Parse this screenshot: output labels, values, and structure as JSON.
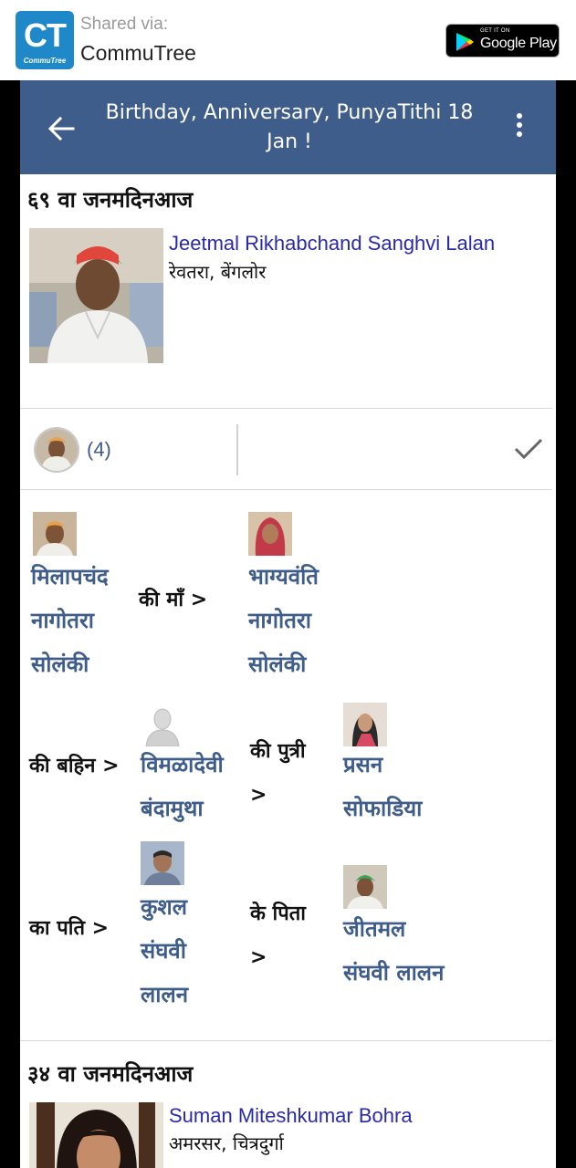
{
  "share_bar": {
    "logo_text": "CT",
    "logo_subtext": "CommuTree",
    "shared_via": "Shared via:",
    "app_name": "CommuTree",
    "store_badge": {
      "small": "GET IT ON",
      "big": "Google Play"
    }
  },
  "appbar": {
    "title": "Birthday, Anniversary, PunyaTithi 18 Jan !",
    "back_icon": "arrow-left-icon",
    "menu_icon": "more-vertical-icon"
  },
  "entries": [
    {
      "heading": "६९ वा जनमदिनआज",
      "name": "Jeetmal Rikhabchand Sanghvi Lalan",
      "place": "रेवतरा, बेंगलोर"
    },
    {
      "heading": "३४ वा जनमदिनआज",
      "name": "Suman Miteshkumar Bohra",
      "place": "अमरसर, चित्रदुर्गा"
    }
  ],
  "reactions": {
    "count": "(4)",
    "check_icon": "checkmark-icon"
  },
  "relations": {
    "row1": {
      "from_name": [
        "मिलापचंद",
        "नागोतरा",
        "सोलंकी"
      ],
      "relation": "की माँ >",
      "to_name": [
        "भाग्यवंति",
        "नागोतरा",
        "सोलंकी"
      ]
    },
    "row2": {
      "prefix": "की बहिन >",
      "from_name": [
        "विमळादेवी",
        "बंदामुथा"
      ],
      "relation": [
        "की पुत्री",
        ">"
      ],
      "to_name": [
        "प्रसन",
        "सोफाडिया"
      ]
    },
    "row3": {
      "prefix": "का पति >",
      "from_name": [
        "कुशल",
        "संघवी",
        "लालन"
      ],
      "relation": [
        "के पिता",
        ">"
      ],
      "to_name": [
        "जीतमल",
        "संघवी लालन"
      ]
    }
  }
}
